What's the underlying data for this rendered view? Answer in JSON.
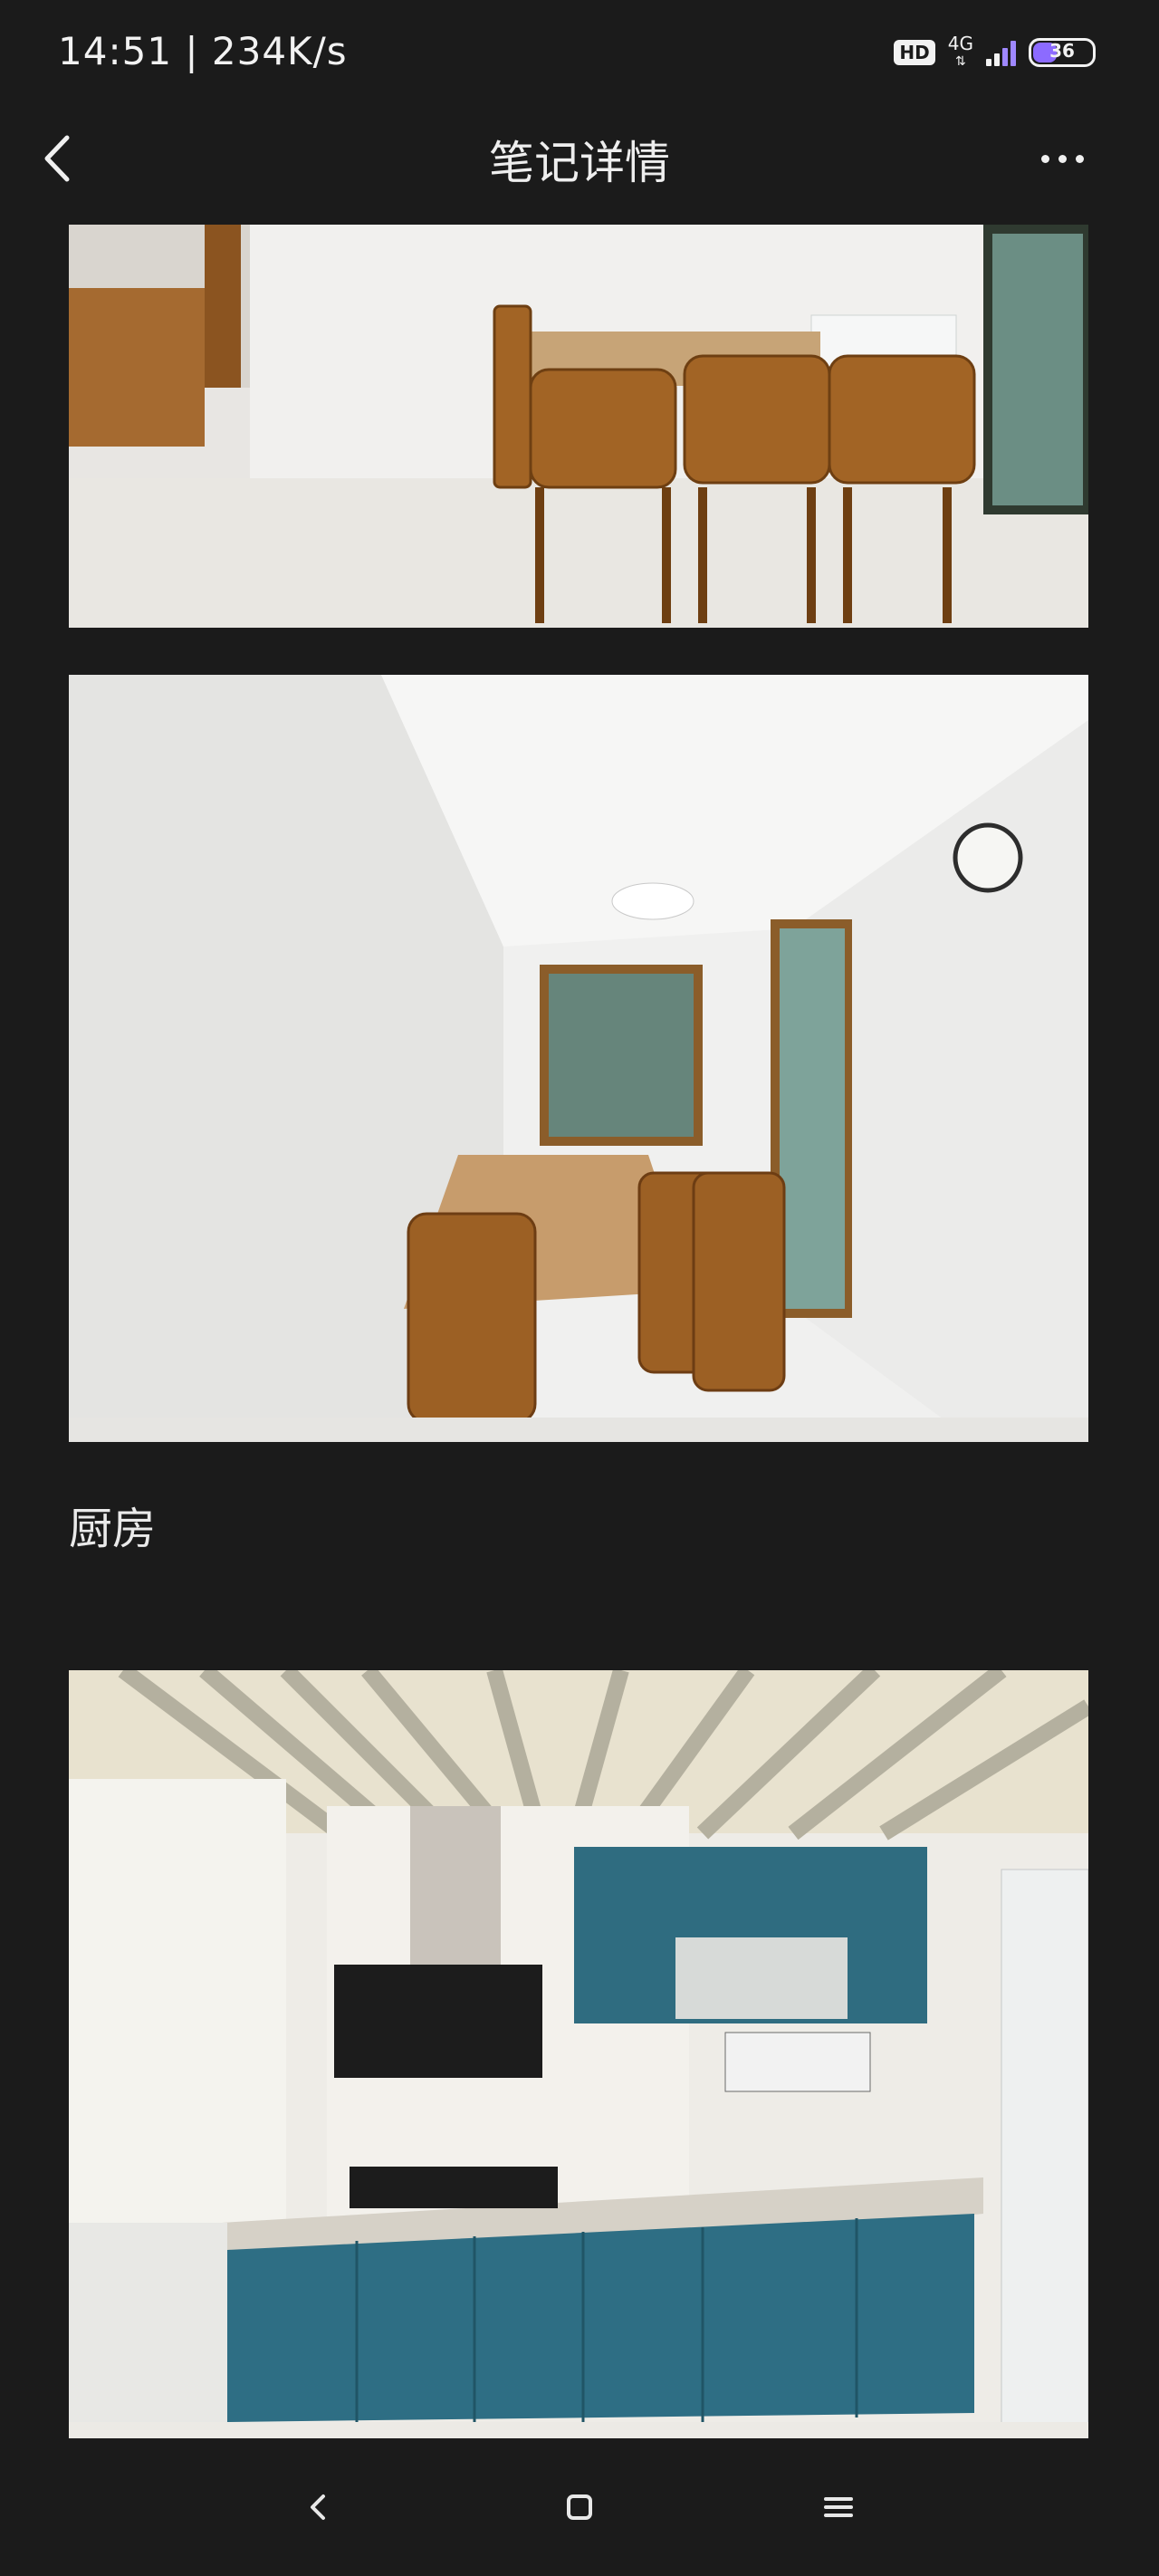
{
  "status_bar": {
    "time_speed": "14:51 | 234K/s",
    "hd": "HD",
    "network": "4G",
    "battery": "36"
  },
  "header": {
    "title": "笔记详情"
  },
  "content": {
    "section_label": "厨房"
  },
  "icons": {
    "back": "chevron-left-icon",
    "more": "more-dots-icon",
    "nav_back": "nav-back-icon",
    "nav_home": "nav-home-icon",
    "nav_menu": "nav-menu-icon"
  }
}
